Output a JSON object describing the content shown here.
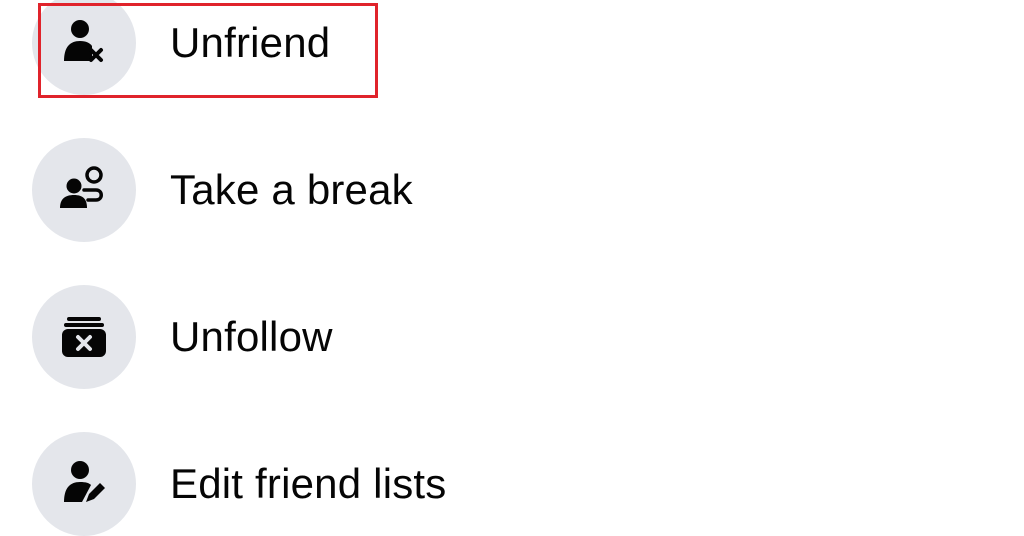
{
  "menu": {
    "items": [
      {
        "label": "Unfriend",
        "icon": "unfriend-icon"
      },
      {
        "label": "Take a break",
        "icon": "take-a-break-icon"
      },
      {
        "label": "Unfollow",
        "icon": "unfollow-icon"
      },
      {
        "label": "Edit friend lists",
        "icon": "edit-friend-lists-icon"
      }
    ]
  },
  "colors": {
    "icon_bg": "#e4e6eb",
    "icon_fg": "#050505",
    "text": "#050505",
    "highlight": "#e0232b",
    "background": "#ffffff"
  }
}
